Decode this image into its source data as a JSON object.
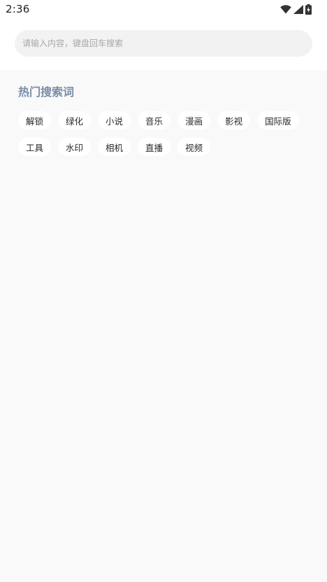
{
  "status_bar": {
    "time": "2:36",
    "icons": [
      "wifi-icon",
      "signal-icon",
      "battery-charging-icon"
    ]
  },
  "search": {
    "placeholder": "请输入内容，键盘回车搜索",
    "value": ""
  },
  "hot_searches": {
    "title": "热门搜索词",
    "rows": [
      [
        "解锁",
        "绿化",
        "小说",
        "音乐",
        "漫画",
        "影视",
        "国际版"
      ],
      [
        "工具",
        "水印",
        "相机",
        "直播",
        "视频"
      ]
    ]
  },
  "colors": {
    "title": "#7a8ca6",
    "page_background": "#f9f9f9",
    "search_box": "#f2f2f2",
    "tag_background": "#ffffff"
  }
}
